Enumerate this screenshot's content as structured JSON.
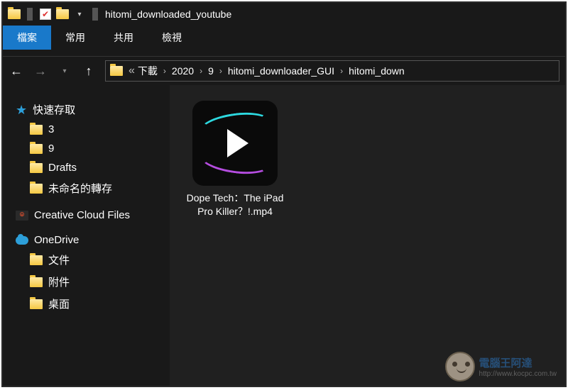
{
  "titlebar": {
    "title": "hitomi_downloaded_youtube"
  },
  "ribbon": {
    "tabs": {
      "file": "檔案",
      "home": "常用",
      "share": "共用",
      "view": "檢視"
    }
  },
  "breadcrumb": {
    "overflow": "«",
    "segs": [
      "下載",
      "2020",
      "9",
      "hitomi_downloader_GUI",
      "hitomi_down"
    ]
  },
  "sidebar": {
    "quick": {
      "label": "快速存取",
      "items": [
        "3",
        "9",
        "Drafts",
        "未命名的轉存"
      ]
    },
    "creative": "Creative Cloud Files",
    "onedrive": {
      "label": "OneDrive",
      "items": [
        "文件",
        "附件",
        "桌面"
      ]
    }
  },
  "content": {
    "file": {
      "name": "Dope Tech：The iPad Pro Killer？!.mp4"
    }
  },
  "watermark": {
    "line1": "電腦王阿達",
    "line2": "http://www.kocpc.com.tw"
  }
}
